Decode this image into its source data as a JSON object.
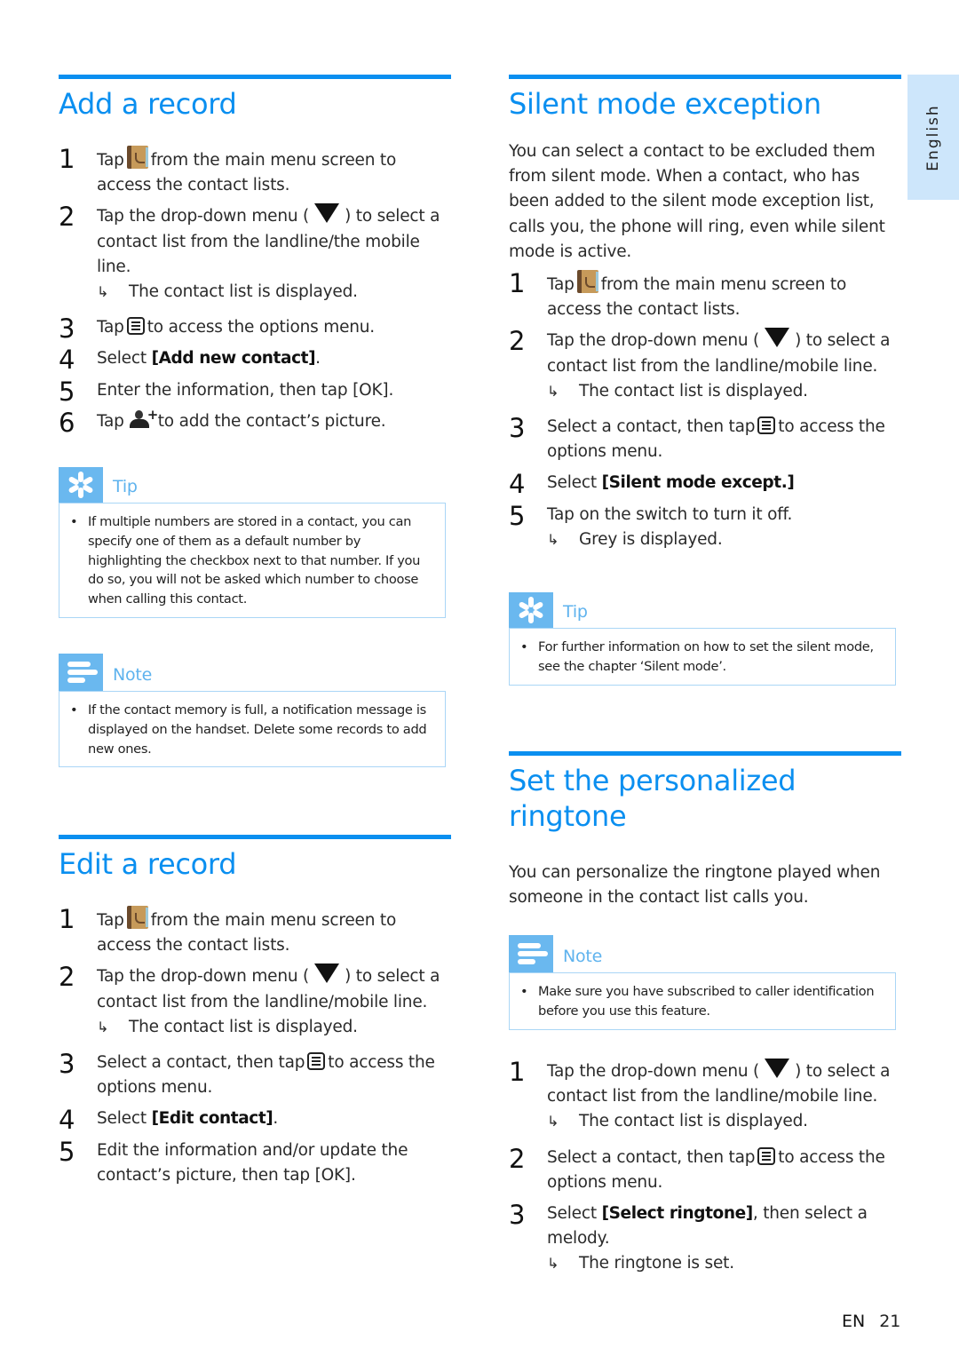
{
  "language_tab": "English",
  "footer": {
    "lang": "EN",
    "page": "21"
  },
  "icons": {
    "contacts_app": "contacts-book-icon",
    "dropdown": "dropdown-triangle-icon",
    "options_menu": "options-menu-icon",
    "add_picture": "add-contact-picture-icon",
    "result_arrow": "result-arrow-icon",
    "tip": "tip-asterisk-icon",
    "note": "note-lines-icon"
  },
  "colors": {
    "accent": "#0a8ff0",
    "box_icon": "#6ab8ef",
    "box_border": "#aad6f6",
    "lang_tab": "#cde6fb"
  },
  "add_record": {
    "title": "Add a record",
    "steps": [
      {
        "num": "1",
        "pre": "Tap",
        "post": "from the main menu screen to access the contact lists."
      },
      {
        "num": "2",
        "pre": "Tap the drop-down menu (",
        "post": ") to select a contact list from the landline/the mobile line.",
        "result": "The contact list is displayed."
      },
      {
        "num": "3",
        "pre": "Tap",
        "post": "to access the options menu."
      },
      {
        "num": "4",
        "pre": "Select ",
        "kw": "[Add new contact]",
        "post": "."
      },
      {
        "num": "5",
        "pre": "Enter the information, then tap ",
        "kw": "[OK]",
        "post": "."
      },
      {
        "num": "6",
        "pre": "Tap",
        "post": "to add the contact’s picture."
      }
    ],
    "tip": {
      "title": "Tip",
      "text": "If multiple numbers are stored in a contact, you can specify one of them as a default number by highlighting the checkbox next to that number. If you do so, you will not be asked which number to choose when calling this contact."
    },
    "note": {
      "title": "Note",
      "text": "If the contact memory is full, a notification message is displayed on the handset. Delete some records to add new ones."
    }
  },
  "edit_record": {
    "title": "Edit a record",
    "steps": [
      {
        "num": "1",
        "pre": "Tap",
        "post": "from the main menu screen to access the contact lists."
      },
      {
        "num": "2",
        "pre": "Tap the drop-down menu (",
        "post": ") to select a contact list from the landline/mobile line.",
        "result": "The contact list is displayed."
      },
      {
        "num": "3",
        "pre": "Select a contact, then tap",
        "post": "to access the options menu."
      },
      {
        "num": "4",
        "pre": "Select ",
        "kw": "[Edit contact]",
        "post": "."
      },
      {
        "num": "5",
        "pre": "Edit the information and/or update the contact’s picture, then tap ",
        "kw": "[OK]",
        "post": "."
      }
    ]
  },
  "silent_mode": {
    "title": "Silent mode exception",
    "intro": "You can select a contact to be excluded them from silent mode. When a contact, who has been added to the silent mode exception list, calls you, the phone will ring, even while silent mode is active.",
    "steps": [
      {
        "num": "1",
        "pre": "Tap",
        "post": "from the main menu screen to access the contact lists."
      },
      {
        "num": "2",
        "pre": "Tap the drop-down menu (",
        "post": ") to select a contact list from the landline/mobile line.",
        "result": "The contact list is displayed."
      },
      {
        "num": "3",
        "pre": "Select a contact, then tap",
        "post": "to access the options menu."
      },
      {
        "num": "4",
        "pre": "Select ",
        "kw": "[Silent mode except.]",
        "post": ""
      },
      {
        "num": "5",
        "pre": "Tap on the switch to turn it off.",
        "result": "Grey is displayed."
      }
    ],
    "tip": {
      "title": "Tip",
      "text": "For further information on how to set the silent mode, see the chapter ‘Silent mode’."
    }
  },
  "ringtone": {
    "title": "Set the personalized ringtone",
    "intro": "You can personalize the ringtone played when someone in the contact list calls you.",
    "note": {
      "title": "Note",
      "text": "Make sure you have subscribed to caller identification before you use this feature."
    },
    "steps": [
      {
        "num": "1",
        "pre": "Tap the drop-down menu (",
        "post": ") to select a contact list from the landline/mobile line.",
        "result": "The contact list is displayed."
      },
      {
        "num": "2",
        "pre": "Select a contact, then tap",
        "post": "to access the options menu."
      },
      {
        "num": "3",
        "pre": "Select ",
        "kw": "[Select ringtone]",
        "post": ", then select a melody.",
        "result": "The ringtone is set."
      }
    ]
  }
}
